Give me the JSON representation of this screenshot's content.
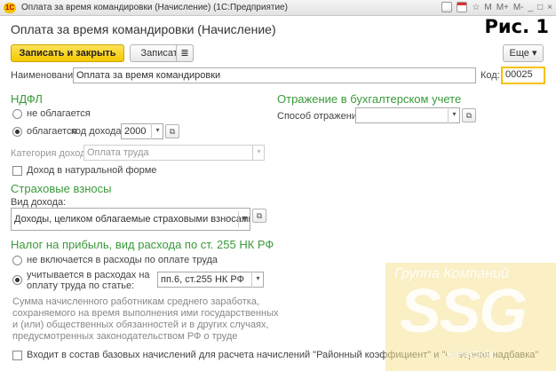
{
  "window": {
    "title": "Оплата за время командировки (Начисление)  (1С:Предприятие)",
    "logo": "1С",
    "icons": [
      "doc-icon",
      "calendar-icon",
      "star-icon"
    ],
    "memory_buttons": [
      "M",
      "M+",
      "M-"
    ],
    "window_controls": [
      "_",
      "□",
      "×"
    ]
  },
  "figure_label": "Рис. 1",
  "form_title": "Оплата за время командировки (Начисление)",
  "toolbar": {
    "save_close": "Записать и закрыть",
    "save": "Записать",
    "more": "Еще",
    "more_arrow": "▾"
  },
  "name": {
    "label": "Наименование:",
    "value": "Оплата за время командировки"
  },
  "code": {
    "label": "Код:",
    "value": "00025"
  },
  "ndfl": {
    "section": "НДФЛ",
    "not_taxed": "не облагается",
    "taxed": "облагается",
    "income_code_label": "код дохода:",
    "income_code": "2000",
    "category_label": "Категория дохода:",
    "category_value": "Оплата труда",
    "in_kind": "Доход в натуральной форме"
  },
  "insurance": {
    "section": "Страховые взносы",
    "income_type_label": "Вид дохода:",
    "income_type": "Доходы, целиком облагаемые страховыми взносами"
  },
  "profit_tax": {
    "section": "Налог на прибыль, вид расхода по ст. 255 НК РФ",
    "not_included": "не включается в расходы по оплате труда",
    "included_line1": "учитывается в расходах на",
    "included_line2": "оплату труда по статье:",
    "article": "пп.6, ст.255 НК РФ",
    "note": "Сумма начисленного работникам среднего заработка, сохраняемого на время выполнения ими государственных и (или) общественных обязанностей и в других случаях, предусмотренных законодательством РФ о труде"
  },
  "accounting": {
    "section": "Отражение в бухгалтерском учете",
    "method_label": "Способ отражения:",
    "method_value": ""
  },
  "base_checkbox": "Входит в состав базовых начислений для расчета начислений \"Районный коэффициент\" и \"Северная надбавка\"",
  "watermark": {
    "group": "Группа Компаний",
    "logo": "SSG",
    "site": "ServisGold"
  },
  "glyphs": {
    "dropdown": "▾",
    "open": "⧉",
    "ellipsis": "…"
  }
}
